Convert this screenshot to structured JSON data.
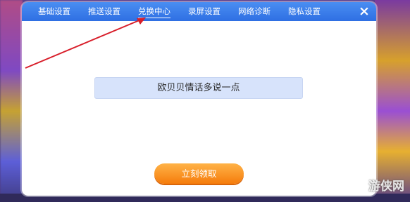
{
  "tabs": [
    {
      "label": "基础设置"
    },
    {
      "label": "推送设置"
    },
    {
      "label": "兑换中心",
      "active": true
    },
    {
      "label": "录屏设置"
    },
    {
      "label": "网络诊断"
    },
    {
      "label": "隐私设置"
    }
  ],
  "close_icon": "×",
  "code_input": {
    "placeholder": "欧贝贝情话多说一点"
  },
  "claim_button": {
    "label": "立刻领取"
  },
  "watermark": {
    "text": "游侠网"
  },
  "colors": {
    "tab_bar": "#3a7ff0",
    "claim_button": "#f7931e",
    "input_bg": "#d7e3fb",
    "annotation": "#d81e2a"
  }
}
